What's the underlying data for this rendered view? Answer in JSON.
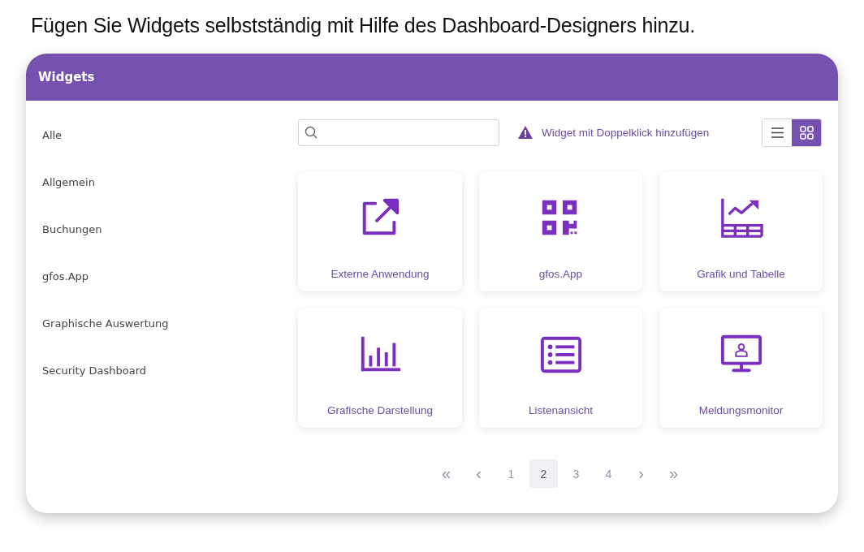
{
  "caption": "Fügen Sie Widgets selbstständig mit Hilfe des Dashboard-Designers hinzu.",
  "panel": {
    "title": "Widgets"
  },
  "sidebar": {
    "items": [
      {
        "label": "Alle",
        "selected": false
      },
      {
        "label": "Allgemein",
        "selected": false
      },
      {
        "label": "Buchungen",
        "selected": false
      },
      {
        "label": "gfos.App",
        "selected": false
      },
      {
        "label": "Graphische Auswertung",
        "selected": false
      },
      {
        "label": "Security Dashboard",
        "selected": false
      }
    ]
  },
  "hint": "Widget mit Doppelklick hinzufügen",
  "view_toggle": [
    {
      "kind": "list",
      "selected": false
    },
    {
      "kind": "grid",
      "selected": true
    }
  ],
  "widgets": [
    {
      "kind": "external",
      "label": "Externe Anwendung"
    },
    {
      "kind": "qr",
      "label": "gfos.App"
    },
    {
      "kind": "chart-table",
      "label": "Grafik und Tabelle"
    },
    {
      "kind": "bars",
      "label": "Grafische Darstellung"
    },
    {
      "kind": "list",
      "label": "Listenansicht"
    },
    {
      "kind": "monitor",
      "label": "Meldungsmonitor"
    }
  ],
  "pagination": [
    {
      "kind": "first",
      "label": "«",
      "selected": false
    },
    {
      "kind": "prev",
      "label": "‹",
      "selected": false
    },
    {
      "kind": "page",
      "label": "1",
      "selected": false
    },
    {
      "kind": "page",
      "label": "2",
      "selected": true
    },
    {
      "kind": "page",
      "label": "3",
      "selected": false
    },
    {
      "kind": "page",
      "label": "4",
      "selected": false
    },
    {
      "kind": "next",
      "label": "›",
      "selected": false
    },
    {
      "kind": "last",
      "label": "»",
      "selected": false
    }
  ]
}
